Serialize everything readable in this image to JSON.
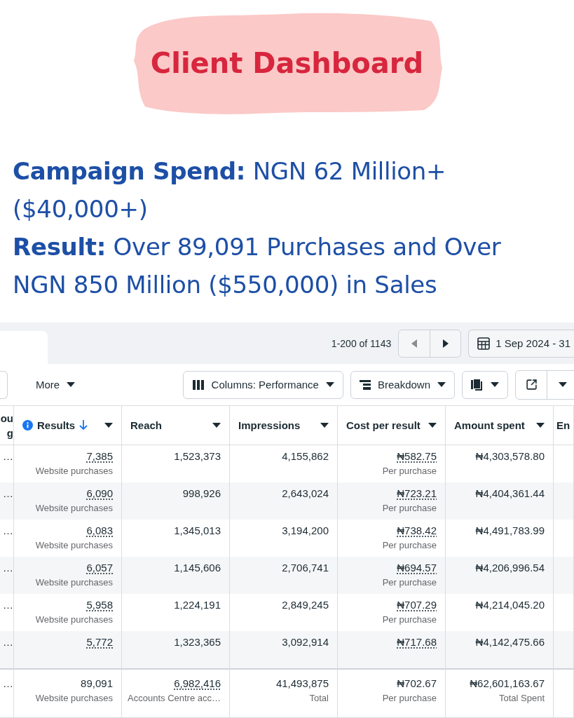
{
  "title": "Client Dashboard",
  "highlights": [
    "**Campaign Spend:** NGN 62 Million+ ($40,000+)",
    "**Result:** Over 89,091 Purchases and Over NGN 850 Million ($550,000) in Sales"
  ],
  "report": {
    "pagination": "1-200 of 1143",
    "date_range": "1 Sep 2024 - 31",
    "toolbar": {
      "more": "More",
      "columns": "Columns: Performance",
      "breakdown": "Breakdown"
    },
    "columns": [
      {
        "label": "ou g"
      },
      {
        "label": "Results",
        "info": true,
        "sorted": true,
        "menu": true
      },
      {
        "label": "Reach",
        "info": false,
        "sorted": false,
        "menu": true
      },
      {
        "label": "Impressions",
        "info": false,
        "sorted": false,
        "menu": true
      },
      {
        "label": "Cost per result",
        "info": false,
        "sorted": false,
        "menu": true
      },
      {
        "label": "Amount spent",
        "info": false,
        "sorted": false,
        "menu": true
      },
      {
        "label": "En"
      }
    ],
    "blank_last_column": true,
    "rows": [
      {
        "cells": [
          {
            "value": "…"
          },
          {
            "value": "7,385",
            "sub": "Website purchases",
            "underlined": true
          },
          {
            "value": "1,523,373"
          },
          {
            "value": "4,155,862"
          },
          {
            "value": "₦582.75",
            "sub": "Per purchase",
            "underlined": true
          },
          {
            "value": "₦4,303,578.80"
          }
        ]
      },
      {
        "cells": [
          {
            "value": "…"
          },
          {
            "value": "6,090",
            "sub": "Website purchases",
            "underlined": true
          },
          {
            "value": "998,926"
          },
          {
            "value": "2,643,024"
          },
          {
            "value": "₦723.21",
            "sub": "Per purchase",
            "underlined": true
          },
          {
            "value": "₦4,404,361.44"
          }
        ]
      },
      {
        "cells": [
          {
            "value": "…"
          },
          {
            "value": "6,083",
            "sub": "Website purchases",
            "underlined": true
          },
          {
            "value": "1,345,013"
          },
          {
            "value": "3,194,200"
          },
          {
            "value": "₦738.42",
            "sub": "Per purchase",
            "underlined": true
          },
          {
            "value": "₦4,491,783.99"
          }
        ]
      },
      {
        "cells": [
          {
            "value": "…"
          },
          {
            "value": "6,057",
            "sub": "Website purchases",
            "underlined": true
          },
          {
            "value": "1,145,606"
          },
          {
            "value": "2,706,741"
          },
          {
            "value": "₦694.57",
            "sub": "Per purchase",
            "underlined": true
          },
          {
            "value": "₦4,206,996.54"
          }
        ]
      },
      {
        "cells": [
          {
            "value": "…"
          },
          {
            "value": "5,958",
            "sub": "Website purchases",
            "underlined": true
          },
          {
            "value": "1,224,191"
          },
          {
            "value": "2,849,245"
          },
          {
            "value": "₦707.29",
            "sub": "Per purchase",
            "underlined": true
          },
          {
            "value": "₦4,214,045.20"
          }
        ]
      },
      {
        "cells": [
          {
            "value": "…"
          },
          {
            "value": "5,772",
            "underlined": true
          },
          {
            "value": "1,323,365"
          },
          {
            "value": "3,092,914"
          },
          {
            "value": "₦717.68",
            "underlined": true
          },
          {
            "value": "₦4,142,475.66"
          }
        ]
      }
    ],
    "totals": [
      {
        "value": "…"
      },
      {
        "value": "89,091",
        "sub": "Website purchases"
      },
      {
        "value": "6,982,416",
        "sub": "Accounts Centre acc…",
        "underlined": true
      },
      {
        "value": "41,493,875",
        "sub": "Total"
      },
      {
        "value": "₦702.67",
        "sub": "Per purchase"
      },
      {
        "value": "₦62,601,163.67",
        "sub": "Total Spent"
      }
    ]
  }
}
